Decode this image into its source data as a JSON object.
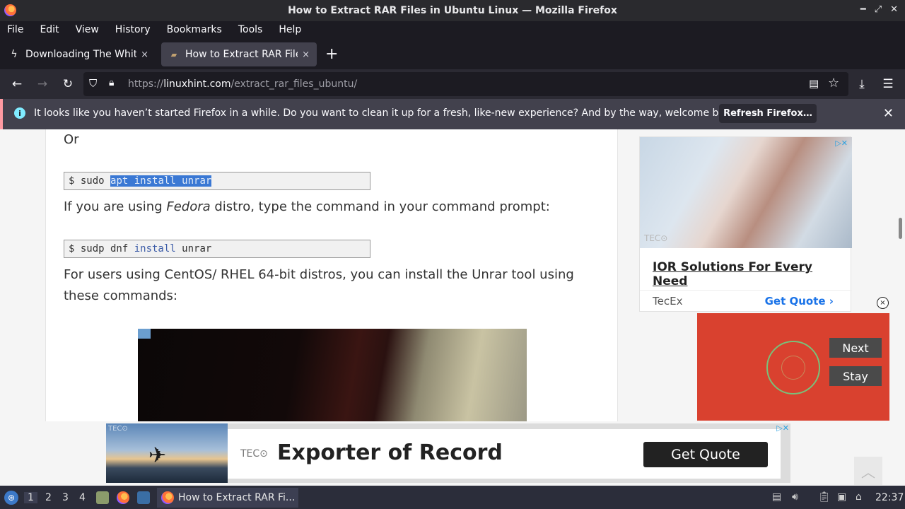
{
  "window": {
    "title": "How to Extract RAR Files in Ubuntu Linux — Mozilla Firefox",
    "controls": [
      "minimize",
      "maximize",
      "close"
    ]
  },
  "menubar": {
    "items": [
      "File",
      "Edit",
      "View",
      "History",
      "Bookmarks",
      "Tools",
      "Help"
    ]
  },
  "tabs": [
    {
      "title": "Downloading The White Lotus",
      "active": false,
      "close": "×"
    },
    {
      "title": "How to Extract RAR Files in Ubuntu Linux",
      "active": true,
      "close": "×"
    }
  ],
  "newtab_label": "+",
  "navbar": {
    "url_prefix": "https://",
    "url_domain": "linuxhint.com",
    "url_path": "/extract_rar_files_ubuntu/"
  },
  "notification": {
    "message": "It looks like you haven’t started Firefox in a while. Do you want to clean it up for a fresh, like-new experience? And by the way, welcome back!",
    "button": "Refresh Firefox…",
    "close": "✕"
  },
  "article": {
    "or_text": "Or",
    "code1": {
      "prompt": "$ sudo ",
      "selected": "apt install unrar"
    },
    "fedora_pre": "If you are using ",
    "fedora_em": "Fedora",
    "fedora_post": " distro, type the command in your command prompt:",
    "code2": {
      "prompt": "$ sudp dnf ",
      "kw": "install",
      "rest": " unrar"
    },
    "centos_text_line1": "For users using CentOS/ RHEL 64-bit distros, you can install the Unrar tool using",
    "centos_text_line2": "these commands:"
  },
  "side_ad": {
    "badge": "▷✕",
    "logo": "TEC⊙",
    "headline": "IOR Solutions For Every Need",
    "advertiser": "TecEx",
    "cta": "Get Quote ›"
  },
  "video_ad": {
    "close": "×",
    "next": "Next",
    "stay": "Stay"
  },
  "bottom_ad": {
    "mark": "TEC⊙",
    "logo": "TEC⊙",
    "headline": "Exporter of Record",
    "cta": "Get Quote",
    "badge": "▷✕",
    "scrolltop": "︿"
  },
  "taskbar": {
    "workspaces": [
      "1",
      "2",
      "3",
      "4"
    ],
    "active_task": "How to Extract RAR Fi...",
    "clock": "22:37"
  }
}
